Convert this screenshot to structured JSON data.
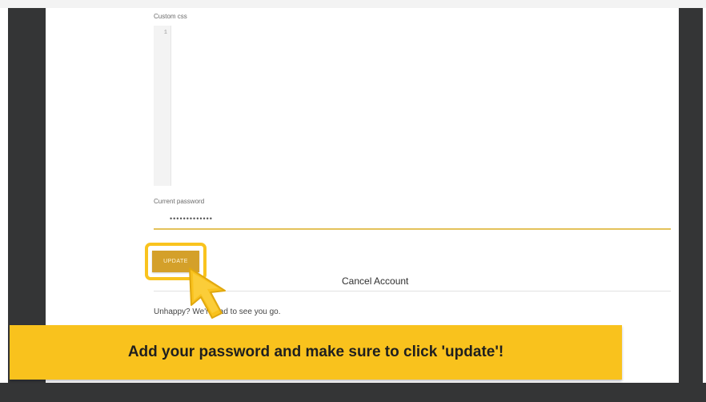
{
  "settings": {
    "custom_css_label": "Custom css",
    "editor_line_number": "1",
    "current_password_label": "Current password",
    "current_password_value": "•••••••••••••",
    "update_label": "UPDATE"
  },
  "cancel_account": {
    "title": "Cancel Account",
    "message": "Unhappy? We're sad to see you go."
  },
  "tutorial": {
    "banner_text": "Add your password and make sure to click 'update'!",
    "pointer_icon": "arrow-cursor-icon"
  },
  "colors": {
    "accent_yellow": "#f9c21d",
    "update_button": "#d4a02a",
    "frame_dark": "#343536",
    "input_underline": "#e4c25a"
  }
}
